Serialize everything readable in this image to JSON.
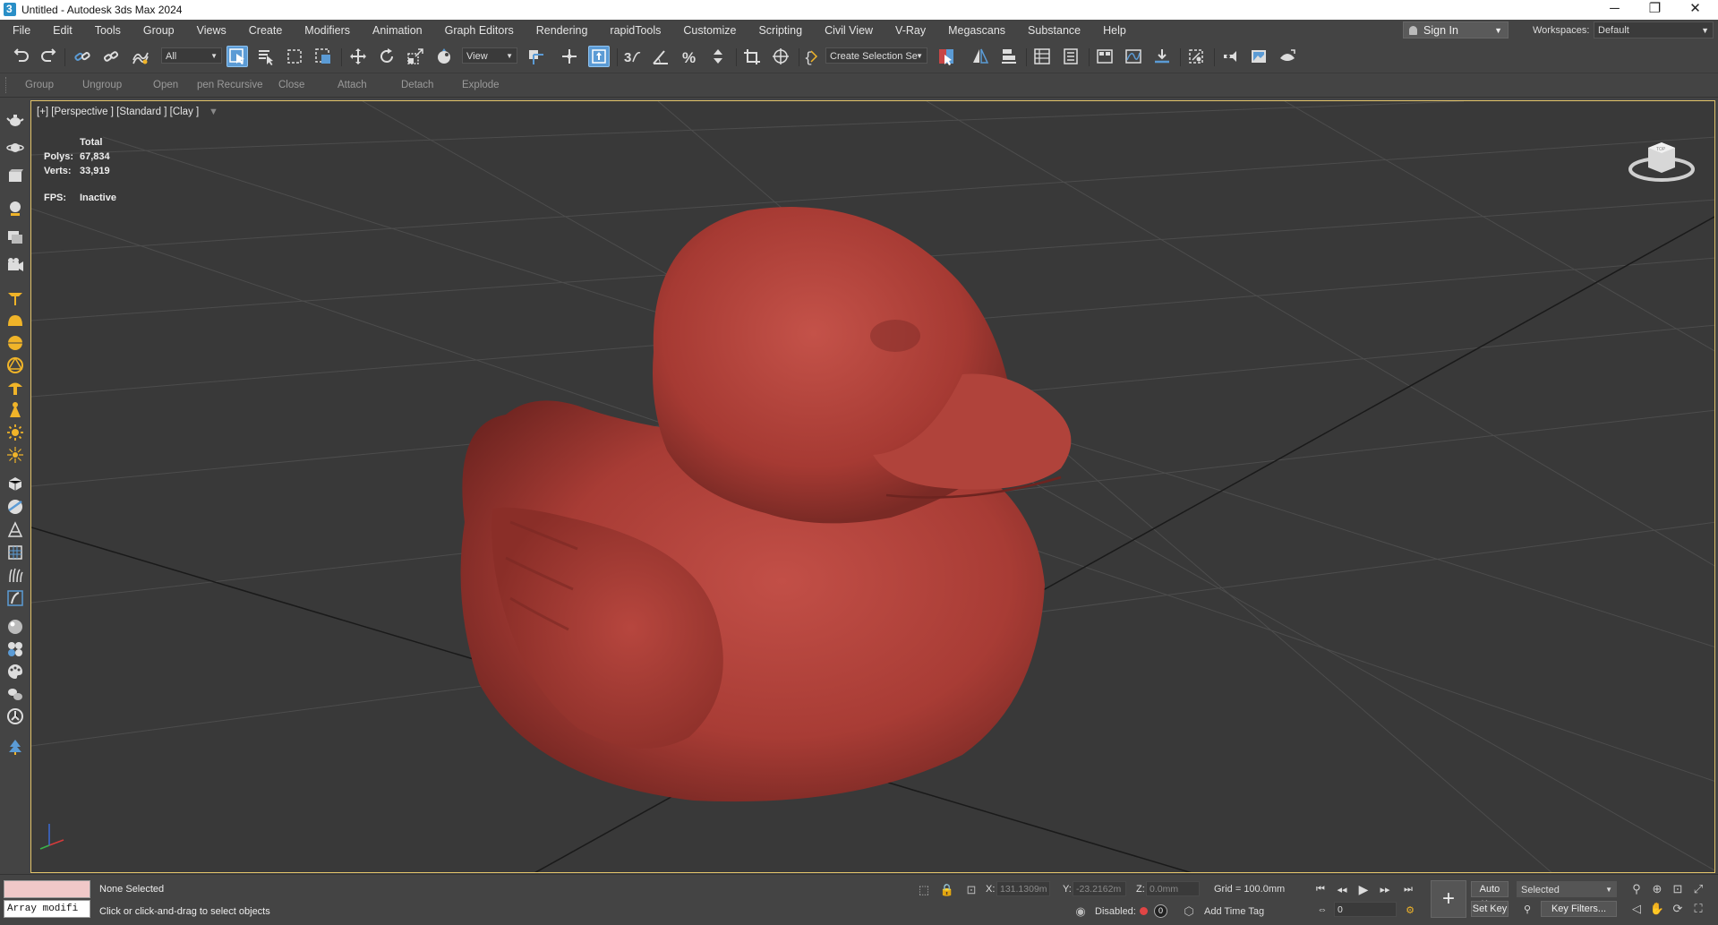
{
  "window": {
    "title": "Untitled - Autodesk 3ds Max 2024",
    "minimize": "─",
    "maximize": "❐",
    "close": "✕"
  },
  "menu": [
    "File",
    "Edit",
    "Tools",
    "Group",
    "Views",
    "Create",
    "Modifiers",
    "Animation",
    "Graph Editors",
    "Rendering",
    "rapidTools",
    "Customize",
    "Scripting",
    "Civil View",
    "V-Ray",
    "Megascans",
    "Substance",
    "Help"
  ],
  "account": {
    "sign_in": "Sign In",
    "workspaces_label": "Workspaces:",
    "workspace_value": "Default"
  },
  "toolbar": {
    "selection_filter": "All",
    "reference_coord": "View",
    "named_selection": "Create Selection Se"
  },
  "ribbon": [
    "Group",
    "Ungroup",
    "Open",
    "pen Recursive",
    "Close",
    "Attach",
    "Detach",
    "Explode"
  ],
  "viewport": {
    "label": "[+] [Perspective ] [Standard ] [Clay ]",
    "stats_header": "Total",
    "polys_label": "Polys:",
    "polys": "67,834",
    "verts_label": "Verts:",
    "verts": "33,919",
    "fps_label": "FPS:",
    "fps": "Inactive",
    "viewcube_text": "TOP"
  },
  "status": {
    "maxscript_text": "Array modifi",
    "selection": "None Selected",
    "prompt": "Click or click-and-drag to select objects",
    "x_label": "X:",
    "x_value": "131.1309m",
    "y_label": "Y:",
    "y_value": "-23.2162m",
    "z_label": "Z:",
    "z_value": "0.0mm",
    "grid": "Grid = 100.0mm",
    "disabled_label": "Disabled:",
    "disabled_count": "0",
    "add_time_tag": "Add Time Tag",
    "auto_key": "Auto Key",
    "set_key": "Set Key",
    "key_mode": "Selected",
    "frame": "0",
    "key_filters": "Key Filters..."
  },
  "colors": {
    "accent": "#5b9bd5",
    "viewport_border": "#e3c46a",
    "duck": "#b5413a",
    "create_panel_icons": "#f0b429"
  }
}
